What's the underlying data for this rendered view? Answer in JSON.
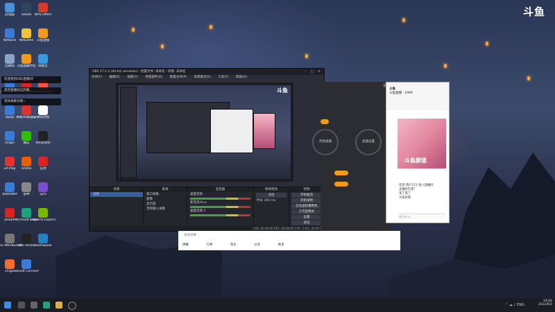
{
  "brand_logo": "斗鱼",
  "colors": {
    "accent_orange": "#f39a1e",
    "obs_bg": "#2b2e38",
    "taskbar": "#1c1d24",
    "selection_blue": "#3a5da0"
  },
  "desktop_icons": [
    {
      "label": "此电脑",
      "icon": "computer-icon",
      "color": "#4a90d9"
    },
    {
      "label": "Steam",
      "icon": "steam-icon",
      "color": "#2a475e"
    },
    {
      "label": "WPS Office",
      "icon": "wps-icon",
      "color": "#d83a30"
    },
    {
      "label": "Network",
      "icon": "network-icon",
      "color": "#3a7bd5"
    },
    {
      "label": "WeGame",
      "icon": "wegame-icon",
      "color": "#f0c040"
    },
    {
      "label": "斗鱼直播",
      "icon": "douyu-icon",
      "color": "#f39a1e"
    },
    {
      "label": "回收站",
      "icon": "recycle-bin-icon",
      "color": "#8aa4c8"
    },
    {
      "label": "斗鱼直播伴侣",
      "icon": "companion-icon",
      "color": "#f39a1e"
    },
    {
      "label": "网易云",
      "icon": "cloud-icon",
      "color": "#3a9ae0"
    },
    {
      "label": "Control Panel",
      "icon": "control-panel-icon",
      "color": "#3a7bd5"
    },
    {
      "label": "网易云音乐",
      "icon": "music-icon",
      "color": "#d22"
    },
    {
      "label": "WeGame版",
      "icon": "wegame2-icon",
      "color": "#e54"
    },
    {
      "label": "Uplay",
      "icon": "uplay-icon",
      "color": "#3a7bd5"
    },
    {
      "label": "网易UU加速器",
      "icon": "uu-icon",
      "color": "#d33"
    },
    {
      "label": "腾讯文档",
      "icon": "doc-icon",
      "color": "#fff"
    },
    {
      "label": "Origin",
      "icon": "origin-icon",
      "color": "#3a7bd5"
    },
    {
      "label": "微信",
      "icon": "wechat-icon",
      "color": "#2dc100"
    },
    {
      "label": "Templater",
      "icon": "templater-icon",
      "color": "#222"
    },
    {
      "label": "EA Play",
      "icon": "ea-icon",
      "color": "#d33"
    },
    {
      "label": "Firefox",
      "icon": "firefox-icon",
      "color": "#e66000"
    },
    {
      "label": "应用",
      "icon": "app-icon",
      "color": "#d22"
    },
    {
      "label": "BattleNet",
      "icon": "battlenet-icon",
      "color": "#3a7bd5"
    },
    {
      "label": "雷神",
      "icon": "thunder-icon",
      "color": "#888"
    },
    {
      "label": "Lyra",
      "icon": "lyra-icon",
      "color": "#7a4fc9"
    },
    {
      "label": "Joseph",
      "icon": "joseph-icon",
      "color": "#d22"
    },
    {
      "label": "Microsoft Edge",
      "icon": "edge-icon",
      "color": "#1ea37a"
    },
    {
      "label": "GeForce Experience",
      "icon": "geforce-icon",
      "color": "#76b900"
    },
    {
      "label": "MSI Afterburner",
      "icon": "afterburner-icon",
      "color": "#777"
    },
    {
      "label": "OBS Studio",
      "icon": "obs-icon",
      "color": "#222"
    },
    {
      "label": "TeamSpeak",
      "icon": "teamspeak-icon",
      "color": "#2580c3"
    },
    {
      "label": "Origin",
      "icon": "origin2-icon",
      "color": "#f56c2d"
    },
    {
      "label": "Ubisoft Connect",
      "icon": "ubisoft-icon",
      "color": "#3a7bd5"
    }
  ],
  "notifications": [
    "欢迎来到OBS直播间!",
    "您的直播间已开播...",
    "等你来聊天哦~"
  ],
  "obs": {
    "title": "OBS 27.2.3 (64-bit, windows) - 配置文件: 未命名 - 场景: 未命名",
    "menu": [
      "文件(F)",
      "编辑(E)",
      "视图(V)",
      "停靠部件(D)",
      "配置文件(P)",
      "场景集合(S)",
      "工具(T)",
      "帮助(H)"
    ],
    "docks": {
      "scenes": {
        "title": "场景",
        "items": [
          "场景"
        ]
      },
      "sources": {
        "title": "来源",
        "items": [
          "窗口采集",
          "图像",
          "显示器",
          "音频输入采集"
        ]
      },
      "mixer": {
        "title": "混音器",
        "channels": [
          "桌面音频",
          "麦克风/Aux",
          "桌面音频 2"
        ]
      },
      "transitions": {
        "title": "转场特效",
        "type": "淡出",
        "duration_label": "时长",
        "duration": "300 ms"
      },
      "controls": {
        "title": "控制",
        "buttons": [
          "开始推流",
          "开始录制",
          "启动虚拟摄像机",
          "工作室模式",
          "设置",
          "退出"
        ]
      }
    },
    "status": "LIVE: 00:00:00  REC: 00:00:00  CPU: 2.8%, 30.00 fps"
  },
  "douyu_panel": {
    "top_action": "退出",
    "circle_left": "开始直播",
    "circle_right": "直播设置"
  },
  "chat_bar": {
    "placeholder": "发送弹幕...",
    "actions": [
      "弹幕",
      "礼物",
      "音乐",
      "分享",
      "更多"
    ]
  },
  "right_panel": {
    "name": "斗鱼",
    "subtitle": "斗鱼直播 · 1999",
    "banner_text": "斗鱼颜值",
    "chat_lines": [
      "欢迎 用户123 进入直播间",
      "主播好厉害!",
      "来了来了",
      "大家好呀"
    ],
    "input_placeholder": "说点什么..."
  },
  "taskbar": {
    "time": "19:04",
    "date": "2022/6/2",
    "lang": "ENG"
  }
}
